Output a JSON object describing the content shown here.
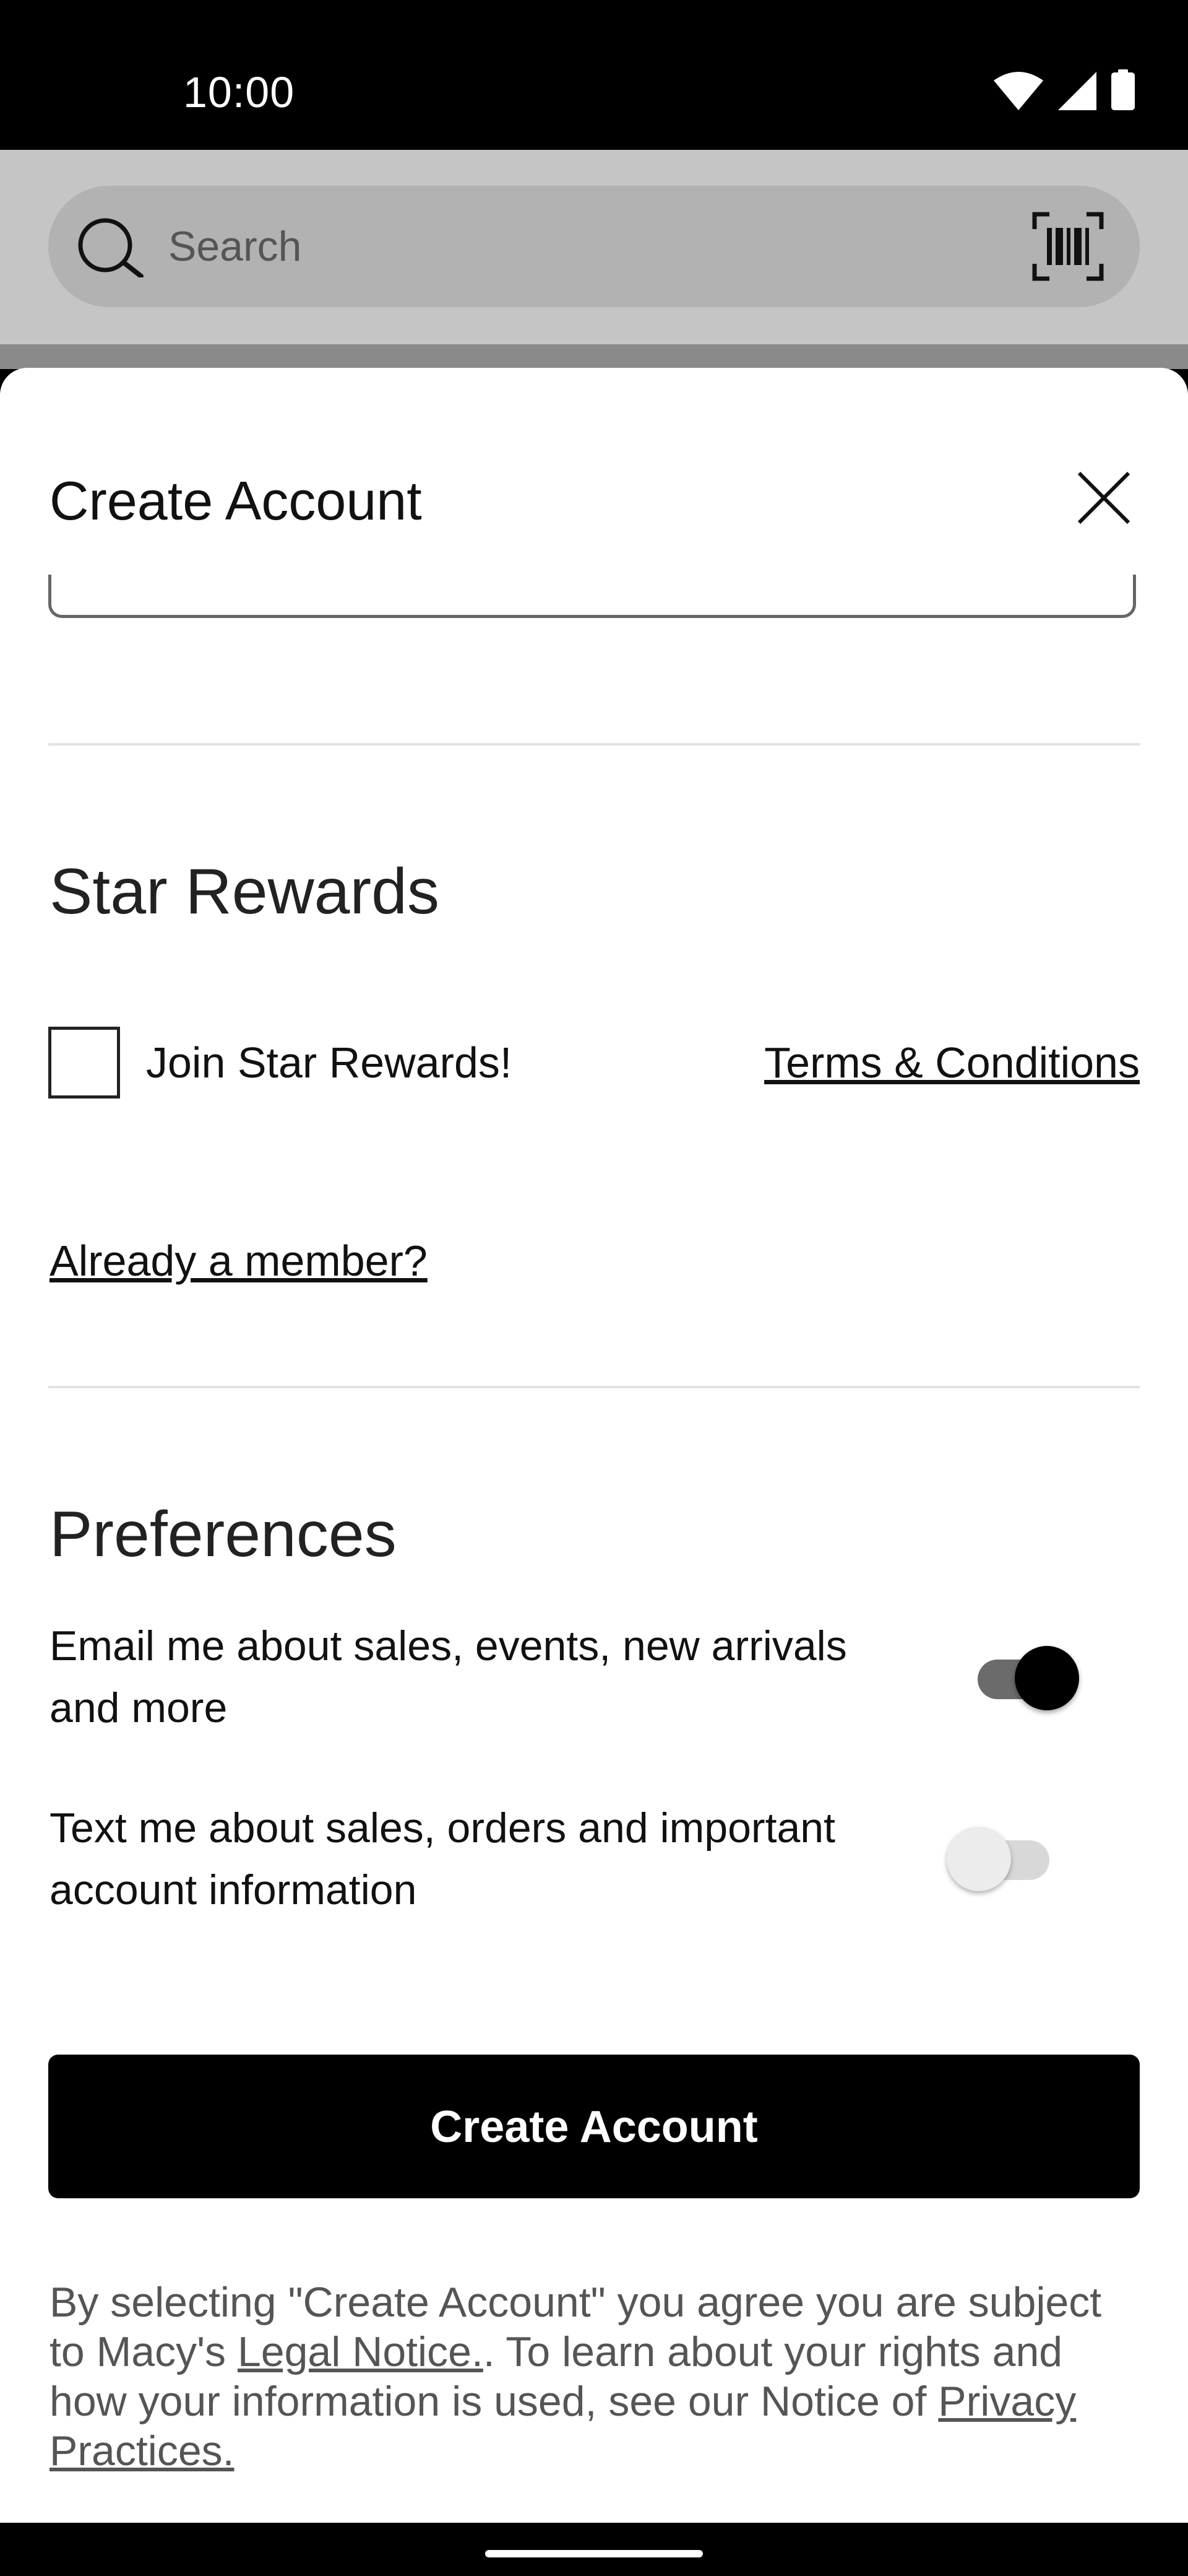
{
  "status_bar": {
    "time": "10:00",
    "icons": [
      "wifi-icon",
      "signal-icon",
      "battery-icon"
    ]
  },
  "search": {
    "placeholder": "Search",
    "icons": [
      "search-icon",
      "barcode-scan-icon"
    ]
  },
  "sheet": {
    "title": "Create Account",
    "close_icon": "close-icon"
  },
  "star_rewards": {
    "heading": "Star Rewards",
    "join_label": "Join Star Rewards!",
    "join_checked": false,
    "terms_link": "Terms & Conditions",
    "member_link": "Already a member?"
  },
  "preferences": {
    "heading": "Preferences",
    "email_label": "Email me about sales, events, new arrivals and more",
    "email_enabled": true,
    "text_label": "Text me about sales, orders and important account information",
    "text_enabled": false
  },
  "actions": {
    "create_account_label": "Create Account"
  },
  "legal": {
    "part1": "By selecting \"Create Account\" you agree you are subject to Macy's ",
    "legal_link": "Legal Notice.",
    "part2": ". To learn about your rights and how your information is used, see our Notice of ",
    "privacy_link": "Privacy Practices."
  },
  "colors": {
    "primary": "#000000",
    "app_bar": "#c5c5c5",
    "search_field": "#b2b2b2",
    "text": "#111111",
    "muted_text": "#555555"
  }
}
